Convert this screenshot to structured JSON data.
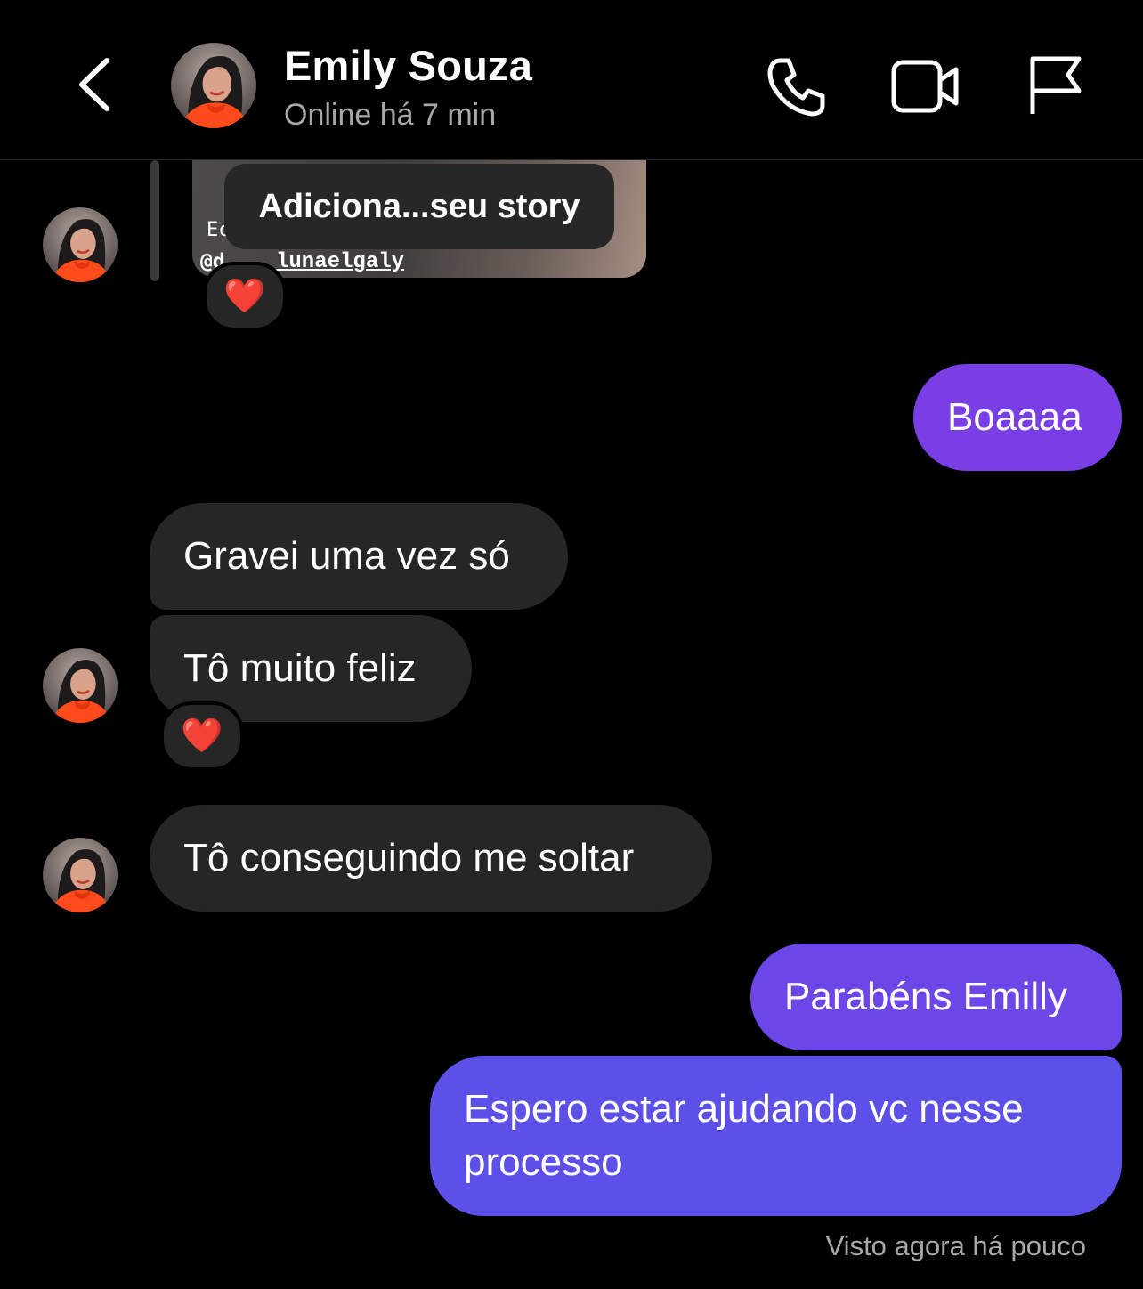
{
  "header": {
    "contact_name": "Emily Souza",
    "status": "Online há 7 min",
    "icons": [
      "back-arrow-icon",
      "phone-icon",
      "video-camera-icon",
      "flag-icon"
    ]
  },
  "story": {
    "label": "Adiciona...seu story",
    "text_fragment": "Ec",
    "mention_prefix": "@d",
    "handle": "lunaelgaly",
    "reaction": "❤️"
  },
  "messages": [
    {
      "direction": "outgoing",
      "text": "Boaaaa"
    },
    {
      "direction": "incoming",
      "text": "Gravei uma vez só"
    },
    {
      "direction": "incoming",
      "text": "Tô muito feliz",
      "reaction": "❤️"
    },
    {
      "direction": "incoming",
      "text": "Tô conseguindo me soltar"
    },
    {
      "direction": "outgoing",
      "text": "Parabéns Emilly"
    },
    {
      "direction": "outgoing",
      "text": "Espero estar ajudando vc nesse processo"
    }
  ],
  "seen_status": "Visto agora há pouco",
  "colors": {
    "background": "#000000",
    "incoming_bubble": "#262626",
    "outgoing_top": "#7b3fe4",
    "outgoing_bottom": "#5b52e8",
    "secondary_text": "#a8a8a8"
  }
}
